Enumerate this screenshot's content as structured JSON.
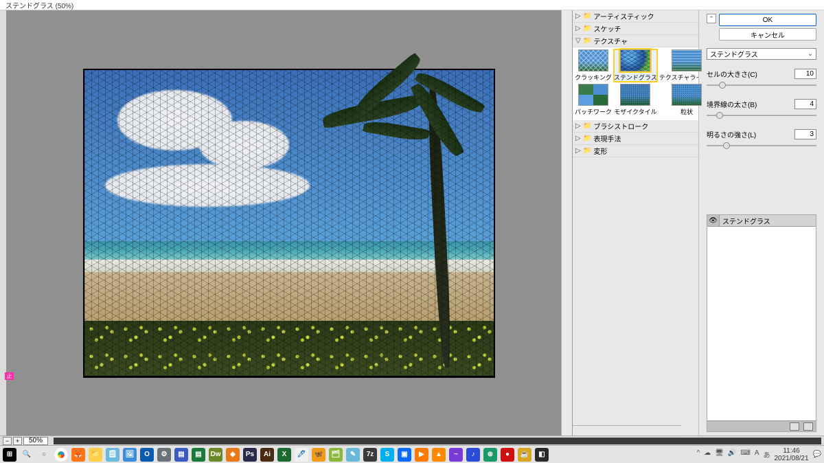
{
  "window": {
    "title": "ステンドグラス (50%)"
  },
  "zoom": {
    "value": "50%"
  },
  "categories": [
    {
      "label": "アーティスティック",
      "open": false
    },
    {
      "label": "スケッチ",
      "open": false
    },
    {
      "label": "テクスチャ",
      "open": true
    },
    {
      "label": "ブラシストローク",
      "open": false
    },
    {
      "label": "表現手法",
      "open": false
    },
    {
      "label": "変形",
      "open": false
    }
  ],
  "texture_thumbs": [
    {
      "label": "クラッキング",
      "cls": "crack"
    },
    {
      "label": "ステンドグラス",
      "cls": "glass",
      "selected": true
    },
    {
      "label": "テクスチャライザー",
      "cls": "tex"
    },
    {
      "label": "パッチワーク",
      "cls": "patch"
    },
    {
      "label": "モザイクタイル",
      "cls": "mos"
    },
    {
      "label": "粒状",
      "cls": "grain"
    }
  ],
  "buttons": {
    "ok": "OK",
    "cancel": "キャンセル"
  },
  "dropdown": {
    "selected": "ステンドグラス"
  },
  "params": {
    "cell_size": {
      "label": "セルの大きさ(C)",
      "value": "10",
      "pos": 18
    },
    "border": {
      "label": "境界線の太さ(B)",
      "value": "4",
      "pos": 14
    },
    "brightness": {
      "label": "明るさの強さ(L)",
      "value": "3",
      "pos": 24
    }
  },
  "stack": {
    "title": "ステンドグラス"
  },
  "taskbar": {
    "time": "11:46",
    "date": "2021/08/21",
    "icons": [
      {
        "bg": "#000",
        "t": "⊞"
      },
      {
        "bg": "transparent",
        "t": "🔍",
        "fg": "#555"
      },
      {
        "bg": "transparent",
        "t": "○",
        "fg": "#555"
      },
      {
        "bg": "#fff",
        "t": "",
        "ring": "#19a15f|#ea4335|#fbbc05|#4285f4"
      },
      {
        "bg": "#ff7518",
        "t": "🦊"
      },
      {
        "bg": "#ffcf4a",
        "t": "📁"
      },
      {
        "bg": "#6bb8e0",
        "t": "🗒"
      },
      {
        "bg": "#3a8dde",
        "t": "🖼"
      },
      {
        "bg": "#0a5ab0",
        "t": "O"
      },
      {
        "bg": "#6a7278",
        "t": "⚙"
      },
      {
        "bg": "#3a5abf",
        "t": "▤"
      },
      {
        "bg": "#1b7a3a",
        "t": "▤"
      },
      {
        "bg": "#6a8a2a",
        "t": "Dw"
      },
      {
        "bg": "#e87a1a",
        "t": "◆"
      },
      {
        "bg": "#2a2a4a",
        "t": "Ps"
      },
      {
        "bg": "#4a2a10",
        "t": "Ai"
      },
      {
        "bg": "#1b6a30",
        "t": "X"
      },
      {
        "bg": "#f0f0f0",
        "t": "🖊",
        "fg": "#2a7ab8"
      },
      {
        "bg": "#f29a1a",
        "t": "🦋"
      },
      {
        "bg": "#8ab83a",
        "t": "🗂"
      },
      {
        "bg": "#6ab8d8",
        "t": "✎"
      },
      {
        "bg": "#3a3a3a",
        "t": "7z"
      },
      {
        "bg": "#00aff0",
        "t": "S"
      },
      {
        "bg": "#0a6cff",
        "t": "▣"
      },
      {
        "bg": "#ff7a00",
        "t": "▶"
      },
      {
        "bg": "#ff8a00",
        "t": "▲"
      },
      {
        "bg": "#7a3ad8",
        "t": "~"
      },
      {
        "bg": "#2a4ad8",
        "t": "♪"
      },
      {
        "bg": "#1a9a6a",
        "t": "⊕"
      },
      {
        "bg": "#d01010",
        "t": "●"
      },
      {
        "bg": "#daa520",
        "t": "☕"
      },
      {
        "bg": "#2a2a2a",
        "t": "◧"
      }
    ],
    "tray": [
      "^",
      "☁",
      "🖥",
      "🔊",
      "⌨",
      "A",
      "あ"
    ]
  }
}
